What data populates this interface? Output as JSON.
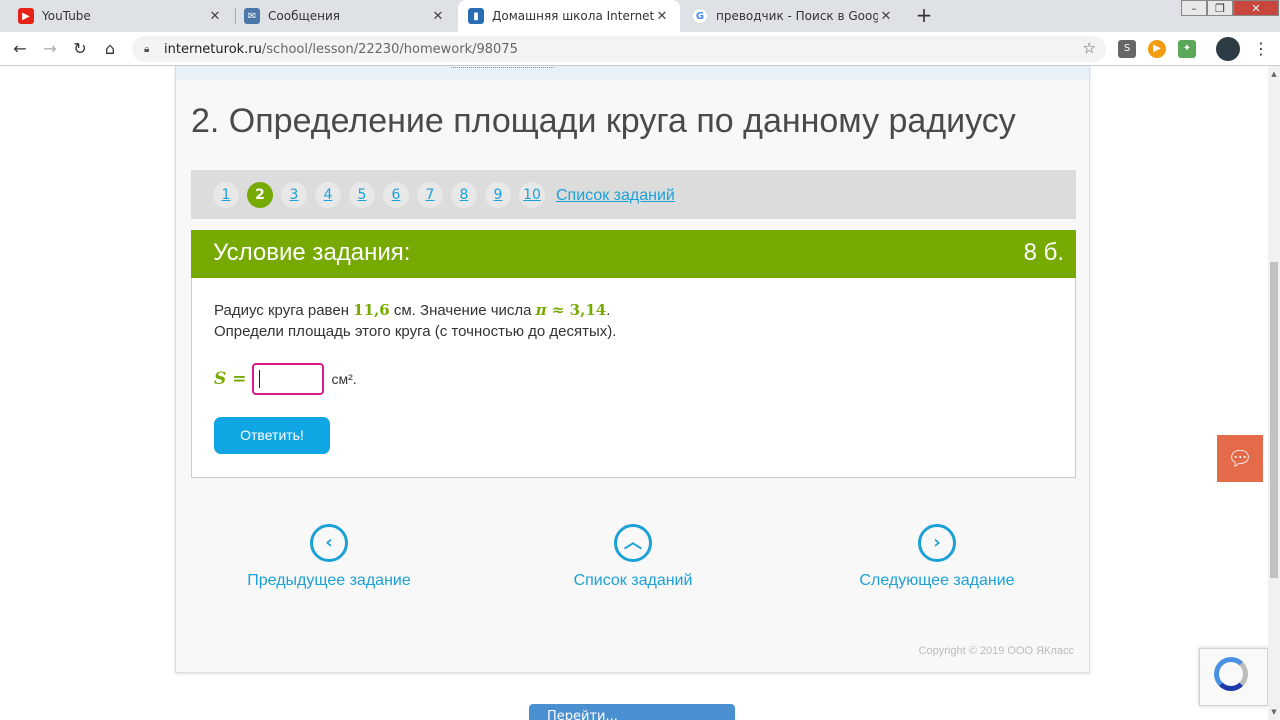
{
  "browser": {
    "tabs": [
      {
        "title": "YouTube",
        "icon": "youtube-icon"
      },
      {
        "title": "Сообщения",
        "icon": "messages-icon"
      },
      {
        "title": "Домашняя школа InternetUrok.r",
        "icon": "internet-urok-icon"
      },
      {
        "title": "преводчик - Поиск в Google",
        "icon": "google-icon"
      }
    ],
    "new_tab_label": "+",
    "url_host": "interneturok.ru",
    "url_path": "/school/lesson/22230/homework/98075"
  },
  "page": {
    "title": "2. Определение площади круга по данному радиусу",
    "pager": {
      "numbers": [
        "1",
        "2",
        "3",
        "4",
        "5",
        "6",
        "7",
        "8",
        "9",
        "10"
      ],
      "current": "2",
      "list_link": "Список заданий"
    },
    "task": {
      "header": "Условие задания:",
      "points": "8 б.",
      "line1_a": "Радиус круга равен ",
      "radius": "11,6",
      "line1_b": " см. Значение числа ",
      "pi_symbol": "π",
      "approx": " ≈ ",
      "pi_value": "3,14",
      "line1_end": ".",
      "line2": "Определи площадь этого круга (с точностью до десятых).",
      "formula_left": "S =",
      "answer_value": "",
      "unit": "см².",
      "submit_label": "Ответить!"
    },
    "nav": {
      "prev": "Предыдущее задание",
      "list": "Список заданий",
      "next": "Следующее задание"
    },
    "copyright": "Copyright © 2019 ООО ЯКласс",
    "bottom_button": "Перейти..."
  },
  "colors": {
    "accent_green": "#77aa00",
    "link_blue": "#1ba1d7",
    "submit_blue": "#10a5e3",
    "input_border": "#d81a8c",
    "chat_orange": "#e46b4a"
  }
}
